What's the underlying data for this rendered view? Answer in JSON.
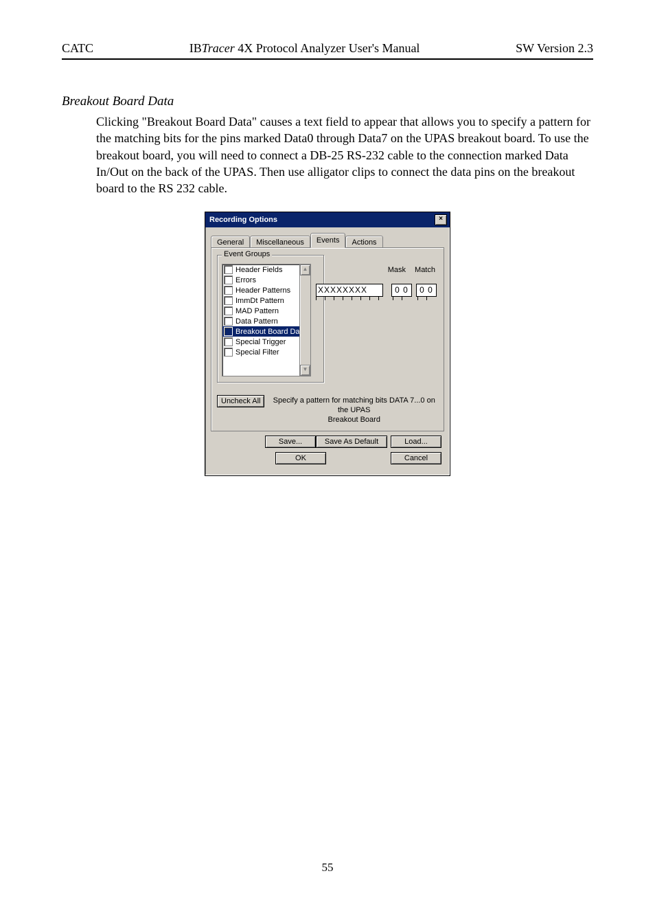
{
  "header": {
    "left": "CATC",
    "center_prefix": "IB",
    "center_italic": "Tracer",
    "center_suffix": " 4X Protocol Analyzer User's Manual",
    "right": "SW Version 2.3"
  },
  "section_heading": "Breakout Board Data",
  "body_text": "Clicking \"Breakout Board Data\" causes a text field to appear that allows you to specify a pattern for the matching bits for the pins marked Data0 through Data7 on the UPAS breakout board. To use the breakout board, you will need to connect a DB-25 RS-232 cable to the connection marked Data In/Out on the back of the UPAS. Then use alligator clips to connect the data pins on the breakout board to the RS 232 cable.",
  "page_number": "55",
  "dialog": {
    "title": "Recording Options",
    "close_x": "×",
    "tabs": [
      "General",
      "Miscellaneous",
      "Events",
      "Actions"
    ],
    "active_tab_index": 2,
    "group_label": "Event Groups",
    "list_items": [
      "Header Fields",
      "Errors",
      "Header Patterns",
      "ImmDt Pattern",
      "MAD Pattern",
      "Data Pattern",
      "Breakout Board Data",
      "Special Trigger",
      "Special Filter"
    ],
    "selected_index": 6,
    "scroll_up": "▲",
    "scroll_down": "▼",
    "right_labels": {
      "mask": "Mask",
      "match": "Match"
    },
    "pattern_field": "XXXXXXXX",
    "mask_field": "0 0",
    "match_field": "0 0",
    "uncheck_all": "Uncheck All",
    "status_msg_line1": "Specify a pattern for matching bits DATA 7...0 on the UPAS",
    "status_msg_line2": "Breakout Board",
    "buttons": {
      "save": "Save...",
      "save_default": "Save As Default",
      "load": "Load...",
      "ok": "OK",
      "cancel": "Cancel"
    }
  }
}
